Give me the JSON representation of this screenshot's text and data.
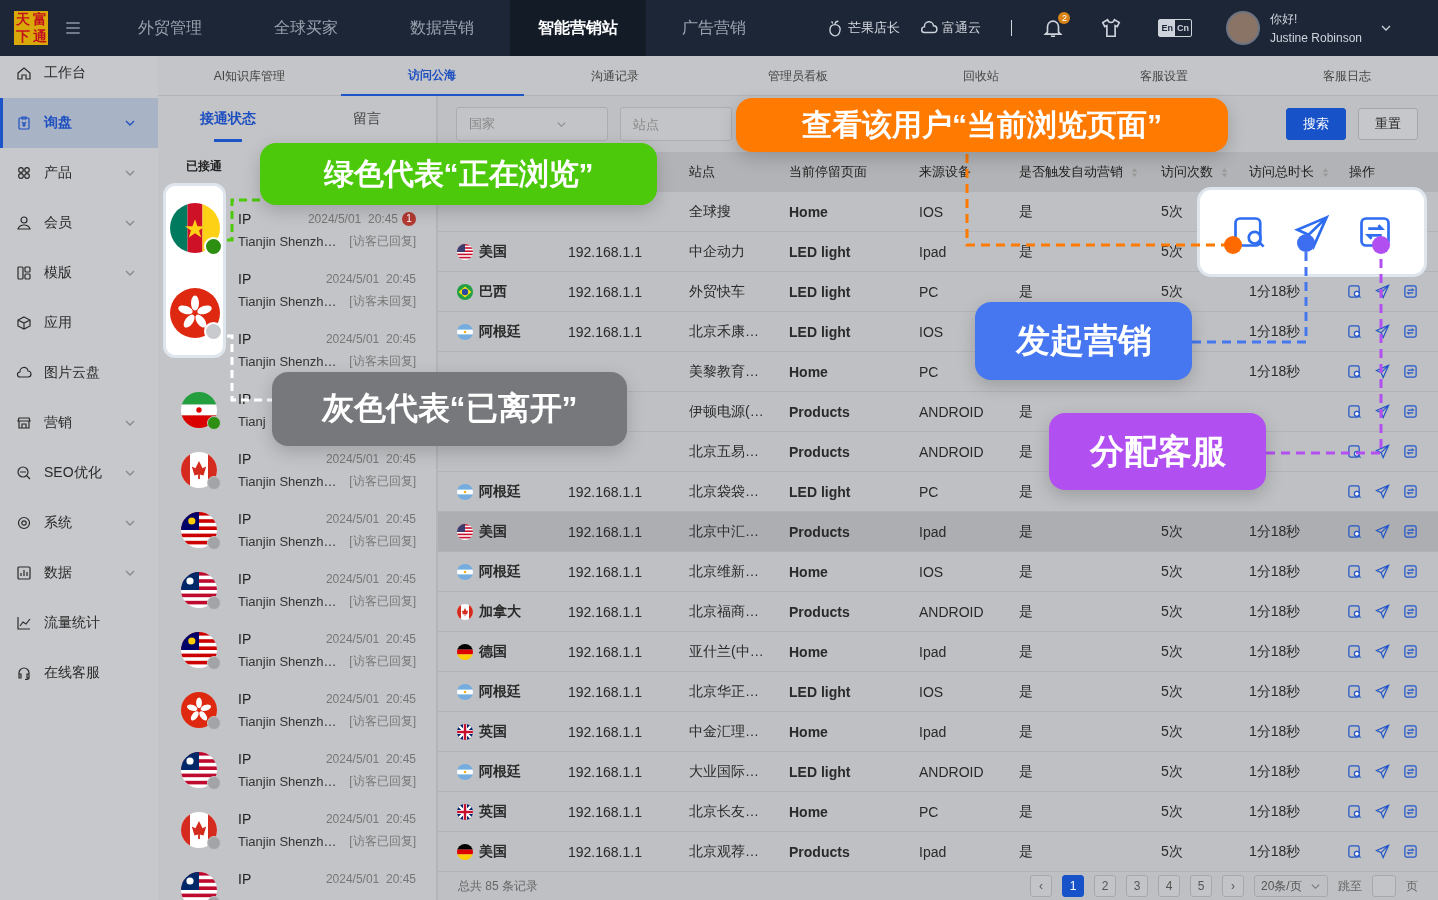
{
  "topbar": {
    "logo": [
      "天",
      "富",
      "下",
      "通"
    ],
    "nav": [
      {
        "label": "外贸管理",
        "selected": false
      },
      {
        "label": "全球买家",
        "selected": false
      },
      {
        "label": "数据营销",
        "selected": false
      },
      {
        "label": "智能营销站",
        "selected": true
      },
      {
        "label": "广告营销",
        "selected": false
      }
    ],
    "shop": "芒果店长",
    "cloud": "富通云",
    "notifications": "2",
    "lang": [
      {
        "label": "En",
        "selected": true
      },
      {
        "label": "Cn",
        "selected": false
      }
    ],
    "greeting": "你好!",
    "user": "Justine Robinson"
  },
  "sidebar": {
    "items": [
      {
        "label": "工作台",
        "selected": false,
        "has_children": false
      },
      {
        "label": "询盘",
        "selected": true,
        "has_children": true
      },
      {
        "label": "产品",
        "selected": false,
        "has_children": true
      },
      {
        "label": "会员",
        "selected": false,
        "has_children": true
      },
      {
        "label": "模版",
        "selected": false,
        "has_children": true
      },
      {
        "label": "应用",
        "selected": false,
        "has_children": false
      },
      {
        "label": "图片云盘",
        "selected": false,
        "has_children": false
      },
      {
        "label": "营销",
        "selected": false,
        "has_children": true
      },
      {
        "label": "SEO优化",
        "selected": false,
        "has_children": true
      },
      {
        "label": "系统",
        "selected": false,
        "has_children": true
      },
      {
        "label": "数据",
        "selected": false,
        "has_children": true
      },
      {
        "label": "流量统计",
        "selected": false,
        "has_children": false
      },
      {
        "label": "在线客服",
        "selected": false,
        "has_children": false
      }
    ]
  },
  "subtabs": [
    {
      "label": "AI知识库管理",
      "selected": false
    },
    {
      "label": "访问公海",
      "selected": true
    },
    {
      "label": "沟通记录",
      "selected": false
    },
    {
      "label": "管理员看板",
      "selected": false
    },
    {
      "label": "回收站",
      "selected": false
    },
    {
      "label": "客服设置",
      "selected": false
    },
    {
      "label": "客服日志",
      "selected": false
    }
  ],
  "visitors": {
    "tabs": [
      {
        "label": "接通状态",
        "selected": true
      },
      {
        "label": "留言",
        "selected": false
      }
    ],
    "group": "已接通",
    "legend": [
      {
        "kind": "cm",
        "online": true
      },
      {
        "kind": "hk",
        "online": false
      }
    ],
    "items": [
      {
        "name": "IP",
        "time": "2024/5/01  20:45",
        "badge": "1",
        "location": "Tianjin Shenzh…",
        "reply": "[访客已回复]"
      },
      {
        "name": "IP",
        "time": "2024/5/01  20:45",
        "location": "Tianjin Shenzh…",
        "reply": "[访客未回复]"
      },
      {
        "name": "IP",
        "time": "2024/5/01  20:45",
        "location": "Tianjin Shenzh…",
        "reply": "[访客未回复]"
      },
      {
        "kind": "ir",
        "online": true,
        "name": "IP",
        "location": "Tianj"
      },
      {
        "kind": "ca",
        "online": false,
        "name": "IP",
        "time": "2024/5/01  20:45",
        "location": "Tianjin Shenzh…",
        "reply": "[访客已回复]"
      },
      {
        "kind": "my",
        "online": false,
        "name": "IP",
        "time": "2024/5/01  20:45",
        "location": "Tianjin Shenzh…",
        "reply": "[访客已回复]"
      },
      {
        "kind": "lr",
        "online": false,
        "name": "IP",
        "time": "2024/5/01  20:45",
        "location": "Tianjin Shenzh…",
        "reply": "[访客已回复]"
      },
      {
        "kind": "my",
        "online": false,
        "name": "IP",
        "time": "2024/5/01  20:45",
        "location": "Tianjin Shenzh…",
        "reply": "[访客已回复]"
      },
      {
        "kind": "hk",
        "online": false,
        "name": "IP",
        "time": "2024/5/01  20:45",
        "location": "Tianjin Shenzh…",
        "reply": "[访客已回复]"
      },
      {
        "kind": "lr",
        "online": false,
        "name": "IP",
        "time": "2024/5/01  20:45",
        "location": "Tianjin Shenzh…",
        "reply": "[访客已回复]"
      },
      {
        "kind": "ca",
        "online": false,
        "name": "IP",
        "time": "2024/5/01  20:45",
        "location": "Tianjin Shenzh…",
        "reply": "[访客已回复]"
      },
      {
        "kind": "lr",
        "online": false,
        "name": "IP",
        "time": "2024/5/01  20:45"
      }
    ]
  },
  "filters": {
    "country": "国家",
    "site": {
      "placeholder": "站点"
    },
    "search": "搜索",
    "reset": "重置"
  },
  "table": {
    "columns": [
      {
        "label": "站点",
        "sortable": false
      },
      {
        "label": "当前停留页面",
        "sortable": false
      },
      {
        "label": "来源设备",
        "sortable": false
      },
      {
        "label": "是否触发自动营销",
        "sortable": true
      },
      {
        "label": "访问次数",
        "sortable": true
      },
      {
        "label": "访问总时长",
        "sortable": true
      },
      {
        "label": "操作",
        "sortable": false
      }
    ],
    "rows": [
      {
        "selected": false,
        "site": "全球搜",
        "page": "Home",
        "device": "IOS",
        "auto": "是",
        "visits": "5次"
      },
      {
        "selected": false,
        "kind": "us",
        "country": "美国",
        "ip": "192.168.1.1",
        "site": "中企动力",
        "page": "LED light",
        "device": "Ipad",
        "auto": "是",
        "visits": "5次"
      },
      {
        "selected": false,
        "kind": "br",
        "country": "巴西",
        "ip": "192.168.1.1",
        "site": "外贸快车",
        "page": "LED light",
        "device": "PC",
        "auto": "是",
        "visits": "5次",
        "duration": "1分18秒"
      },
      {
        "selected": false,
        "kind": "ar",
        "country": "阿根廷",
        "ip": "192.168.1.1",
        "site": "北京禾康…",
        "page": "LED light",
        "device": "IOS",
        "duration": "1分18秒"
      },
      {
        "selected": false,
        "site": "美黎教育…",
        "page": "Home",
        "device": "PC",
        "duration": "1分18秒"
      },
      {
        "selected": false,
        "site": "伊顿电源(…",
        "page": "Products",
        "device": "ANDROID",
        "auto": "是"
      },
      {
        "selected": false,
        "site": "北京五易…",
        "page": "Products",
        "device": "ANDROID",
        "auto": "是"
      },
      {
        "selected": false,
        "kind": "ar",
        "country": "阿根廷",
        "ip": "192.168.1.1",
        "site": "北京袋袋…",
        "page": "LED light",
        "device": "PC",
        "auto": "是"
      },
      {
        "selected": true,
        "kind": "us",
        "country": "美国",
        "ip": "192.168.1.1",
        "site": "北京中汇…",
        "page": "Products",
        "device": "Ipad",
        "auto": "是",
        "visits": "5次",
        "duration": "1分18秒"
      },
      {
        "selected": false,
        "kind": "ar",
        "country": "阿根廷",
        "ip": "192.168.1.1",
        "site": "北京维新…",
        "page": "Home",
        "device": "IOS",
        "auto": "是",
        "visits": "5次",
        "duration": "1分18秒"
      },
      {
        "selected": false,
        "kind": "ca",
        "country": "加拿大",
        "ip": "192.168.1.1",
        "site": "北京福商…",
        "page": "Products",
        "device": "ANDROID",
        "auto": "是",
        "visits": "5次",
        "duration": "1分18秒"
      },
      {
        "selected": false,
        "kind": "de",
        "country": "德国",
        "ip": "192.168.1.1",
        "site": "亚什兰(中…",
        "page": "Home",
        "device": "Ipad",
        "auto": "是",
        "visits": "5次",
        "duration": "1分18秒"
      },
      {
        "selected": false,
        "kind": "ar",
        "country": "阿根廷",
        "ip": "192.168.1.1",
        "site": "北京华正…",
        "page": "LED light",
        "device": "IOS",
        "auto": "是",
        "visits": "5次",
        "duration": "1分18秒"
      },
      {
        "selected": false,
        "kind": "gb",
        "country": "英国",
        "ip": "192.168.1.1",
        "site": "中金汇理…",
        "page": "Home",
        "device": "Ipad",
        "auto": "是",
        "visits": "5次",
        "duration": "1分18秒"
      },
      {
        "selected": false,
        "kind": "ar",
        "country": "阿根廷",
        "ip": "192.168.1.1",
        "site": "大业国际…",
        "page": "LED light",
        "device": "ANDROID",
        "auto": "是",
        "visits": "5次",
        "duration": "1分18秒"
      },
      {
        "selected": false,
        "kind": "gb",
        "country": "英国",
        "ip": "192.168.1.1",
        "site": "北京长友…",
        "page": "Home",
        "device": "PC",
        "auto": "是",
        "visits": "5次",
        "duration": "1分18秒"
      },
      {
        "selected": false,
        "kind": "de",
        "country": "美国",
        "ip": "192.168.1.1",
        "site": "北京观荐…",
        "page": "Products",
        "device": "Ipad",
        "auto": "是",
        "visits": "5次",
        "duration": "1分18秒"
      }
    ]
  },
  "footer": {
    "total": "总共 85 条记录",
    "prev": "‹",
    "next": "›",
    "pages": [
      {
        "label": "1",
        "selected": true
      },
      {
        "label": "2",
        "selected": false
      },
      {
        "label": "3",
        "selected": false
      },
      {
        "label": "4",
        "selected": false
      },
      {
        "label": "5",
        "selected": false
      }
    ],
    "page_size": "20条/页",
    "jump": "跳至",
    "page_unit": "页"
  },
  "callouts": [
    {
      "kind": "online",
      "text": "绿色代表“正在浏览”",
      "color": "#4cc90a"
    },
    {
      "kind": "offline",
      "text": "灰色代表“已离开”",
      "color": "#77787c"
    },
    {
      "kind": "current_page",
      "text": "查看该用户“当前浏览页面”",
      "color": "#ff7a00"
    },
    {
      "kind": "marketing",
      "text": "发起营销",
      "color": "#4677f0"
    },
    {
      "kind": "assign",
      "text": "分配客服",
      "color": "#b24ff0"
    }
  ]
}
